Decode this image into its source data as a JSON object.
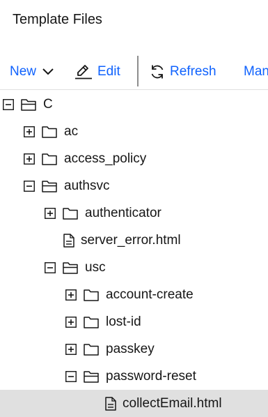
{
  "panel": {
    "title": "Template Files"
  },
  "toolbar": {
    "new_label": "New",
    "edit_label": "Edit",
    "refresh_label": "Refresh",
    "manage_label": "Man",
    "accent_color": "#0f62fe"
  },
  "tree": [
    {
      "label": "C",
      "type": "folder",
      "expanded": true,
      "depth": 0
    },
    {
      "label": "ac",
      "type": "folder",
      "expanded": false,
      "depth": 1
    },
    {
      "label": "access_policy",
      "type": "folder",
      "expanded": false,
      "depth": 1
    },
    {
      "label": "authsvc",
      "type": "folder",
      "expanded": true,
      "depth": 1
    },
    {
      "label": "authenticator",
      "type": "folder",
      "expanded": false,
      "depth": 2
    },
    {
      "label": "server_error.html",
      "type": "file",
      "depth": 2
    },
    {
      "label": "usc",
      "type": "folder",
      "expanded": true,
      "depth": 2
    },
    {
      "label": "account-create",
      "type": "folder",
      "expanded": false,
      "depth": 3
    },
    {
      "label": "lost-id",
      "type": "folder",
      "expanded": false,
      "depth": 3
    },
    {
      "label": "passkey",
      "type": "folder",
      "expanded": false,
      "depth": 3
    },
    {
      "label": "password-reset",
      "type": "folder",
      "expanded": true,
      "depth": 3
    },
    {
      "label": "collectEmail.html",
      "type": "file",
      "depth": 4,
      "selected": true
    }
  ]
}
